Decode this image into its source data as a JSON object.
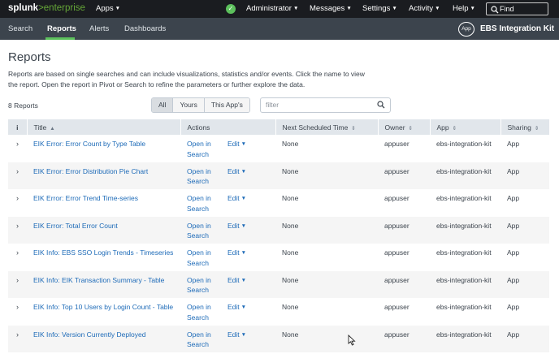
{
  "topbar": {
    "logo_main": "splunk",
    "logo_gt": ">",
    "logo_sub": "enterprise",
    "apps_label": "Apps",
    "status_icon": "check-icon",
    "menus": [
      "Administrator",
      "Messages",
      "Settings",
      "Activity",
      "Help"
    ],
    "find_placeholder": "Find"
  },
  "appbar": {
    "tabs": [
      "Search",
      "Reports",
      "Alerts",
      "Dashboards"
    ],
    "active_tab": "Reports",
    "app_icon_label": "App",
    "app_title": "EBS Integration Kit",
    "accent_color": "#5cc05c"
  },
  "page": {
    "title": "Reports",
    "description": "Reports are based on single searches and can include visualizations, statistics and/or events. Click the name to view the report. Open the report in Pivot or Search to refine the parameters or further explore the data.",
    "count": "8 Reports"
  },
  "filters": {
    "buttons": [
      "All",
      "Yours",
      "This App's"
    ],
    "active": "All",
    "input_placeholder": "filter"
  },
  "table": {
    "headers": {
      "info": "i",
      "title": "Title",
      "title_sort": "▲",
      "actions": "Actions",
      "next_scheduled": "Next Scheduled Time",
      "owner": "Owner",
      "app": "App",
      "sharing": "Sharing",
      "sort_icon": "⇕"
    },
    "expand_glyph": "›",
    "open_in": "Open in",
    "search": "Search",
    "edit": "Edit",
    "rows": [
      {
        "title": "EIK Error: Error Count by Type Table",
        "next": "None",
        "owner": "appuser",
        "app": "ebs-integration-kit",
        "sharing": "App"
      },
      {
        "title": "EIK Error: Error Distribution Pie Chart",
        "next": "None",
        "owner": "appuser",
        "app": "ebs-integration-kit",
        "sharing": "App"
      },
      {
        "title": "EIK Error: Error Trend Time-series",
        "next": "None",
        "owner": "appuser",
        "app": "ebs-integration-kit",
        "sharing": "App"
      },
      {
        "title": "EIK Error: Total Error Count",
        "next": "None",
        "owner": "appuser",
        "app": "ebs-integration-kit",
        "sharing": "App"
      },
      {
        "title": "EIK Info: EBS SSO Login Trends - Timeseries",
        "next": "None",
        "owner": "appuser",
        "app": "ebs-integration-kit",
        "sharing": "App"
      },
      {
        "title": "EIK Info: EIK Transaction Summary - Table",
        "next": "None",
        "owner": "appuser",
        "app": "ebs-integration-kit",
        "sharing": "App"
      },
      {
        "title": "EIK Info: Top 10 Users by Login Count - Table",
        "next": "None",
        "owner": "appuser",
        "app": "ebs-integration-kit",
        "sharing": "App"
      },
      {
        "title": "EIK Info: Version Currently Deployed",
        "next": "None",
        "owner": "appuser",
        "app": "ebs-integration-kit",
        "sharing": "App"
      }
    ]
  }
}
